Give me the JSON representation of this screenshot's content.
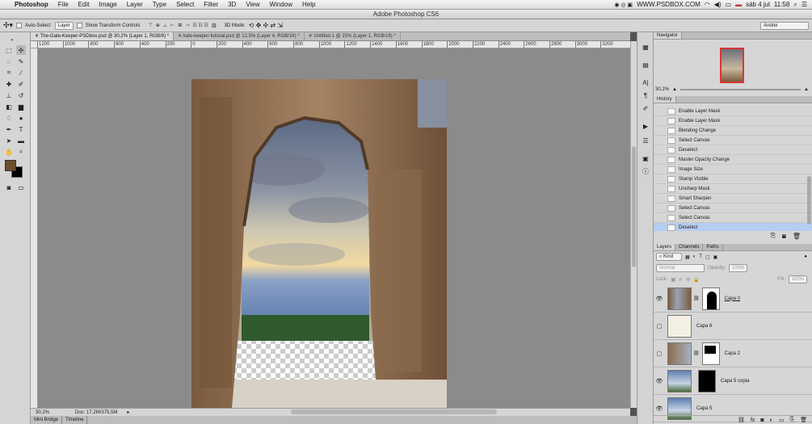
{
  "menubar": {
    "apple": "",
    "app": "Photoshop",
    "items": [
      "File",
      "Edit",
      "Image",
      "Layer",
      "Type",
      "Select",
      "Filter",
      "3D",
      "View",
      "Window",
      "Help"
    ],
    "site": "WWW.PSDBOX.COM",
    "date": "sáb 4 jul",
    "time": "11:58"
  },
  "titlebar": {
    "title": "Adobe Photoshop CS6"
  },
  "options": {
    "auto_select": "Auto-Select:",
    "auto_select_value": "Layer",
    "show_transform": "Show Transform Controls",
    "mode3d": "3D Mode:",
    "workspace": "Andrei"
  },
  "tabs": [
    {
      "label": "The-Gate-Keeper-PSDbox.psd @ 30,2% (Layer 1, RGB/8) *"
    },
    {
      "label": "kate-keeper-tutorial.psd @ 12,5% (Layer 4, RGB/16) *"
    },
    {
      "label": "Untitled-1 @ 25% (Layer 1, RGB/16) *"
    }
  ],
  "ruler": [
    "1200",
    "1000",
    "800",
    "600",
    "400",
    "200",
    "0",
    "200",
    "400",
    "600",
    "800",
    "1000",
    "1200",
    "1400",
    "1600",
    "1800",
    "2000",
    "2200",
    "2400",
    "2600",
    "2800",
    "3000",
    "3200"
  ],
  "status": {
    "zoom": "30,2%",
    "doc": "Doc: 17,2M/375,5M"
  },
  "bottom_tabs": [
    "Mini Bridge",
    "Timeline"
  ],
  "navigator": {
    "title": "Navigator",
    "zoom": "30,2%"
  },
  "history": {
    "title": "History",
    "items": [
      "Enable Layer Mask",
      "Enable Layer Mask",
      "Blending Change",
      "Select Canvas",
      "Deselect",
      "Master Opacity Change",
      "Image Size",
      "Stamp Visible",
      "Unsharp Mask",
      "Smart Sharpen",
      "Select Canvas",
      "Select Canvas",
      "Deselect"
    ]
  },
  "layers": {
    "tabs": [
      "Layers",
      "Channels",
      "Paths"
    ],
    "kind": "Kind",
    "blend": "Normal",
    "opacity_label": "Opacity:",
    "opacity": "100%",
    "lock_label": "Lock:",
    "fill_label": "Fill:",
    "fill": "100%",
    "items": [
      {
        "name": "Capa 0"
      },
      {
        "name": "Capa 6"
      },
      {
        "name": "Capa 2"
      },
      {
        "name": "Capa 5 copia"
      },
      {
        "name": "Capa 5"
      }
    ]
  },
  "colors": {
    "foreground": "#6b4f2e",
    "background": "#000000"
  }
}
